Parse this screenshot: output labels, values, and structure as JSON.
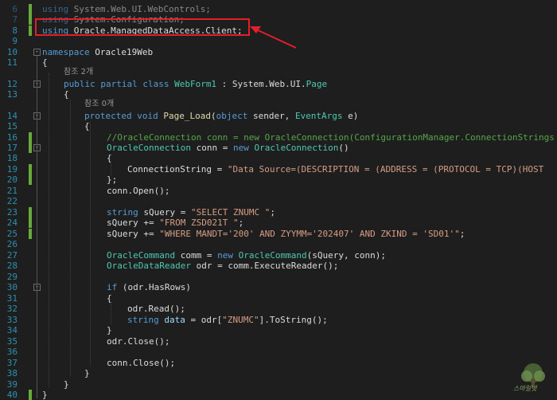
{
  "lines": [
    {
      "n": "6",
      "parts": [
        [
          "k",
          "using"
        ],
        [
          "p",
          " System.Web.UI.WebControls;"
        ]
      ],
      "dim": true
    },
    {
      "n": "7",
      "parts": [
        [
          "k",
          "using"
        ],
        [
          "p",
          " System.Configuration;"
        ]
      ],
      "dim": true
    },
    {
      "n": "8",
      "parts": [
        [
          "k",
          "using"
        ],
        [
          "p",
          " Oracle.ManagedDataAccess.Client;"
        ]
      ]
    },
    {
      "n": "9",
      "parts": []
    },
    {
      "n": "10",
      "parts": [
        [
          "k",
          "namespace"
        ],
        [
          "p",
          " Oracle19Web"
        ]
      ]
    },
    {
      "n": "11",
      "parts": [
        [
          "p",
          "{"
        ]
      ]
    },
    {
      "n": "12",
      "parts": [
        [
          "k",
          "public partial class"
        ],
        [
          "p",
          " "
        ],
        [
          "t",
          "WebForm1"
        ],
        [
          "p",
          " : System.Web.UI."
        ],
        [
          "t",
          "Page"
        ]
      ]
    },
    {
      "n": "13",
      "parts": [
        [
          "p",
          "{"
        ]
      ]
    },
    {
      "n": "14",
      "parts": [
        [
          "k",
          "protected void"
        ],
        [
          "p",
          " "
        ],
        [
          "m",
          "Page_Load"
        ],
        [
          "p",
          "("
        ],
        [
          "k",
          "object"
        ],
        [
          "p",
          " sender, "
        ],
        [
          "t",
          "EventArgs"
        ],
        [
          "p",
          " e)"
        ]
      ]
    },
    {
      "n": "15",
      "parts": [
        [
          "p",
          "{"
        ]
      ]
    },
    {
      "n": "16",
      "parts": [
        [
          "c",
          "//OracleConnection conn = new OracleConnection(ConfigurationManager.ConnectionStrings"
        ]
      ]
    },
    {
      "n": "17",
      "parts": [
        [
          "t",
          "OracleConnection"
        ],
        [
          "p",
          " conn = "
        ],
        [
          "k",
          "new"
        ],
        [
          "p",
          " "
        ],
        [
          "t",
          "OracleConnection"
        ],
        [
          "p",
          "()"
        ]
      ]
    },
    {
      "n": "18",
      "parts": [
        [
          "p",
          "{"
        ]
      ]
    },
    {
      "n": "19",
      "parts": [
        [
          "p",
          "ConnectionString = "
        ],
        [
          "s",
          "\"Data Source=(DESCRIPTION = (ADDRESS = (PROTOCOL = TCP)(HOST"
        ]
      ]
    },
    {
      "n": "20",
      "parts": [
        [
          "p",
          "};"
        ]
      ]
    },
    {
      "n": "21",
      "parts": [
        [
          "p",
          "conn.Open();"
        ]
      ]
    },
    {
      "n": "22",
      "parts": []
    },
    {
      "n": "23",
      "parts": [
        [
          "k",
          "string"
        ],
        [
          "p",
          " sQuery = "
        ],
        [
          "s",
          "\"SELECT ZNUMC \""
        ],
        [
          "p",
          ";"
        ]
      ]
    },
    {
      "n": "24",
      "parts": [
        [
          "p",
          "sQuery += "
        ],
        [
          "s",
          "\"FROM ZSD021T \""
        ],
        [
          "p",
          ";"
        ]
      ]
    },
    {
      "n": "25",
      "parts": [
        [
          "p",
          "sQuery += "
        ],
        [
          "s",
          "\"WHERE MANDT='200' AND ZYYMM='202407' AND ZKIND = 'SD01'\""
        ],
        [
          "p",
          ";"
        ]
      ]
    },
    {
      "n": "26",
      "parts": []
    },
    {
      "n": "27",
      "parts": [
        [
          "t",
          "OracleCommand"
        ],
        [
          "p",
          " comm = "
        ],
        [
          "k",
          "new"
        ],
        [
          "p",
          " "
        ],
        [
          "t",
          "OracleCommand"
        ],
        [
          "p",
          "(sQuery, conn);"
        ]
      ]
    },
    {
      "n": "28",
      "parts": [
        [
          "t",
          "OracleDataReader"
        ],
        [
          "p",
          " odr = comm.ExecuteReader();"
        ]
      ]
    },
    {
      "n": "29",
      "parts": []
    },
    {
      "n": "30",
      "parts": [
        [
          "k",
          "if"
        ],
        [
          "p",
          " (odr.HasRows)"
        ]
      ]
    },
    {
      "n": "31",
      "parts": [
        [
          "p",
          "{"
        ]
      ]
    },
    {
      "n": "32",
      "parts": [
        [
          "p",
          "odr.Read();"
        ]
      ]
    },
    {
      "n": "33",
      "parts": [
        [
          "k",
          "string"
        ],
        [
          "p",
          " "
        ],
        [
          "v",
          "data"
        ],
        [
          "p",
          " = odr["
        ],
        [
          "s",
          "\"ZNUMC\""
        ],
        [
          "p",
          "].ToString();"
        ]
      ]
    },
    {
      "n": "34",
      "parts": [
        [
          "p",
          "}"
        ]
      ]
    },
    {
      "n": "35",
      "parts": [
        [
          "p",
          "odr.Close();"
        ]
      ]
    },
    {
      "n": "36",
      "parts": []
    },
    {
      "n": "37",
      "parts": [
        [
          "p",
          "conn.Close();"
        ]
      ]
    },
    {
      "n": "38",
      "parts": [
        [
          "p",
          "}"
        ]
      ]
    },
    {
      "n": "39",
      "parts": [
        [
          "p",
          "}"
        ]
      ]
    },
    {
      "n": "40",
      "parts": [
        [
          "p",
          "}"
        ]
      ]
    }
  ],
  "codelens": {
    "class_refs": "참조 2개",
    "method_refs": "참조 0개"
  },
  "watermark": "스마일넷"
}
